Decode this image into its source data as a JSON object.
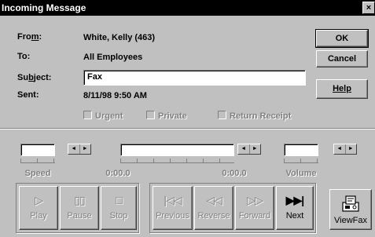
{
  "window": {
    "title": "Incoming Message",
    "close_glyph": "×"
  },
  "header": {
    "from_label": "From:",
    "from_value": "White, Kelly (463)",
    "to_label": "To:",
    "to_value": "All Employees",
    "subject_label": "Subject:",
    "subject_value": "Fax",
    "sent_label": "Sent:",
    "sent_value": "8/11/98  9:50 AM"
  },
  "buttons": {
    "ok": "OK",
    "cancel": "Cancel",
    "help": "Help"
  },
  "options": {
    "urgent": {
      "label": "Urgent",
      "checked": false,
      "enabled": false
    },
    "private": {
      "label": "Private",
      "checked": false,
      "enabled": false
    },
    "return_receipt": {
      "label": "Return Receipt",
      "checked": false,
      "enabled": false
    }
  },
  "playback": {
    "speed_label": "Speed",
    "position_start": "0:00.0",
    "position_end": "0:00.0",
    "volume_label": "Volume",
    "spin_left_glyph": "◄",
    "spin_right_glyph": "►"
  },
  "transport": [
    {
      "id": "play",
      "label": "Play",
      "icon": "play-icon",
      "glyph": "▷",
      "enabled": false
    },
    {
      "id": "pause",
      "label": "Pause",
      "icon": "pause-icon",
      "glyph": "▯▯",
      "enabled": false
    },
    {
      "id": "stop",
      "label": "Stop",
      "icon": "stop-icon",
      "glyph": "□",
      "enabled": false
    },
    {
      "id": "previous",
      "label": "Previous",
      "icon": "previous-icon",
      "glyph": "|◁◁",
      "enabled": false
    },
    {
      "id": "reverse",
      "label": "Reverse",
      "icon": "reverse-icon",
      "glyph": "◁◁",
      "enabled": false
    },
    {
      "id": "forward",
      "label": "Forward",
      "icon": "forward-icon",
      "glyph": "▷▷",
      "enabled": false
    },
    {
      "id": "next",
      "label": "Next",
      "icon": "next-icon",
      "glyph": "▶▶|",
      "enabled": true
    },
    {
      "id": "viewfax",
      "label": "ViewFax",
      "icon": "fax-icon",
      "glyph": "",
      "enabled": true
    }
  ],
  "colors": {
    "face": "#c0c0c0",
    "titlebar": "#000000",
    "disabled_text": "#808080"
  }
}
